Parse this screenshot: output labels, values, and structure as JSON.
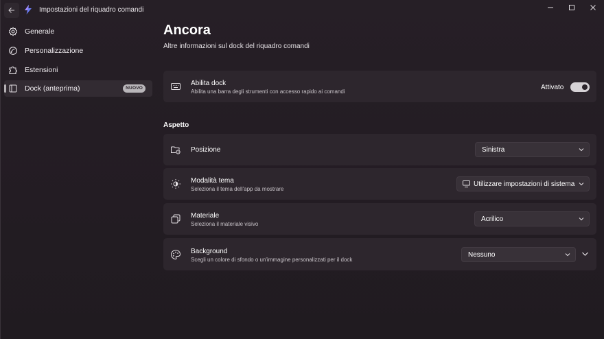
{
  "titlebar": {
    "title": "Impostazioni del riquadro comandi",
    "back_icon": "arrow-left-icon",
    "app_icon": "command-palette-icon",
    "controls": [
      "minimize-icon",
      "maximize-icon",
      "close-icon"
    ]
  },
  "sidebar": {
    "items": [
      {
        "label": "Generale",
        "icon": "gear-icon"
      },
      {
        "label": "Personalizzazione",
        "icon": "brush-icon"
      },
      {
        "label": "Estensioni",
        "icon": "puzzle-icon"
      },
      {
        "label": "Dock (anteprima)",
        "icon": "dock-icon",
        "selected": true,
        "badge": "NUOVO"
      }
    ]
  },
  "page": {
    "title": "Ancora",
    "subtitle": "Altre informazioni sul dock del riquadro comandi"
  },
  "enable_dock": {
    "title": "Abilita dock",
    "description": "Abilita una barra degli strumenti con accesso rapido ai comandi",
    "state_label": "Attivato",
    "enabled": true,
    "icon": "keyboard-icon"
  },
  "appearance": {
    "section_title": "Aspetto",
    "position": {
      "title": "Posizione",
      "value": "Sinistra",
      "icon": "folder-gear-icon"
    },
    "theme": {
      "title": "Modalità tema",
      "description": "Seleziona il tema dell'app da mostrare",
      "value": "Utilizzare impostazioni di sistema",
      "icon": "brightness-icon",
      "value_icon": "monitor-icon"
    },
    "material": {
      "title": "Materiale",
      "description": "Seleziona il materiale visivo",
      "value": "Acrilico",
      "icon": "layers-icon"
    },
    "background": {
      "title": "Background",
      "description": "Scegli un colore di sfondo o un'immagine personalizzati per il dock",
      "value": "Nessuno",
      "icon": "palette-icon"
    }
  },
  "colors": {
    "window_bg": "#231c23",
    "card_bg": "#2d262d",
    "toggle_on": "#d6d2d6",
    "accent": "#7c6cf0"
  }
}
